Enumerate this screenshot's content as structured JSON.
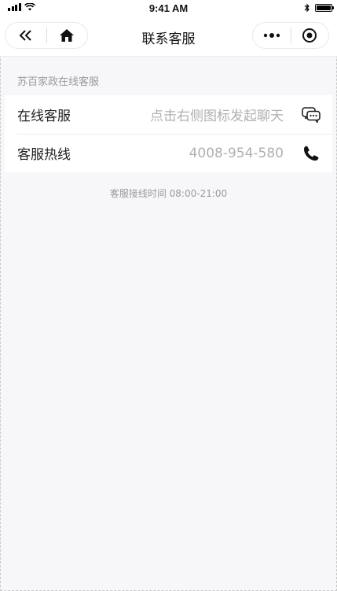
{
  "status_bar": {
    "time": "9:41 AM",
    "icons": [
      "signal-icon",
      "wifi-icon",
      "bluetooth-icon",
      "battery-icon"
    ]
  },
  "nav": {
    "title": "联系客服",
    "left_icons": [
      "back-double-chevron-icon",
      "home-icon"
    ],
    "right_icons": [
      "more-dots-icon",
      "close-target-icon"
    ]
  },
  "section": {
    "header": "苏百家政在线客服",
    "rows": [
      {
        "label": "在线客服",
        "value": "点击右侧图标发起聊天",
        "icon": "chat-bubbles-icon"
      },
      {
        "label": "客服热线",
        "value": "4008-954-580",
        "icon": "phone-icon"
      }
    ]
  },
  "service_hours": "客服接线时间 08:00-21:00",
  "colors": {
    "background": "#f7f7fa",
    "card": "#ffffff",
    "muted_text": "#9a9a9a",
    "value_text": "#b0b0b0"
  }
}
